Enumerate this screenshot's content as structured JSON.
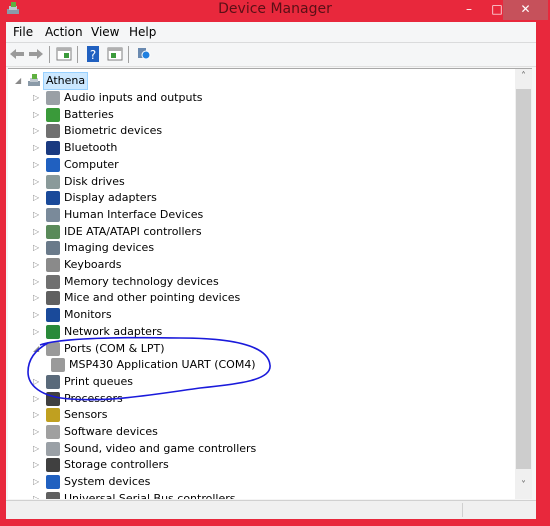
{
  "window": {
    "title": "Device Manager",
    "minimize_glyph": "–",
    "maximize_glyph": "□",
    "close_glyph": "✕"
  },
  "menu": [
    "File",
    "Action",
    "View",
    "Help"
  ],
  "toolbar": {
    "buttons": [
      "back-icon",
      "forward-icon",
      "show-hide-console-tree-icon",
      "help-icon",
      "show-hide-action-pane-icon",
      "scan-hardware-changes-icon"
    ]
  },
  "tree": {
    "root": {
      "label": "Athena",
      "expanded": true,
      "selected": true
    },
    "categories": [
      {
        "label": "Audio inputs and outputs",
        "icon": "speaker-icon",
        "expanded": false
      },
      {
        "label": "Batteries",
        "icon": "battery-icon",
        "expanded": false
      },
      {
        "label": "Biometric devices",
        "icon": "fingerprint-icon",
        "expanded": false
      },
      {
        "label": "Bluetooth",
        "icon": "bluetooth-icon",
        "expanded": false
      },
      {
        "label": "Computer",
        "icon": "computer-icon",
        "expanded": false
      },
      {
        "label": "Disk drives",
        "icon": "disk-drive-icon",
        "expanded": false
      },
      {
        "label": "Display adapters",
        "icon": "display-adapter-icon",
        "expanded": false
      },
      {
        "label": "Human Interface Devices",
        "icon": "hid-icon",
        "expanded": false
      },
      {
        "label": "IDE ATA/ATAPI controllers",
        "icon": "ide-controller-icon",
        "expanded": false
      },
      {
        "label": "Imaging devices",
        "icon": "imaging-device-icon",
        "expanded": false
      },
      {
        "label": "Keyboards",
        "icon": "keyboard-icon",
        "expanded": false
      },
      {
        "label": "Memory technology devices",
        "icon": "memory-device-icon",
        "expanded": false
      },
      {
        "label": "Mice and other pointing devices",
        "icon": "mouse-icon",
        "expanded": false
      },
      {
        "label": "Monitors",
        "icon": "monitor-icon",
        "expanded": false
      },
      {
        "label": "Network adapters",
        "icon": "network-adapter-icon",
        "expanded": false
      },
      {
        "label": "Ports (COM & LPT)",
        "icon": "port-icon",
        "expanded": true,
        "children": [
          {
            "label": "MSP430 Application UART (COM4)",
            "icon": "port-icon"
          }
        ]
      },
      {
        "label": "Print queues",
        "icon": "printer-icon",
        "expanded": false
      },
      {
        "label": "Processors",
        "icon": "processor-icon",
        "expanded": false
      },
      {
        "label": "Sensors",
        "icon": "sensor-icon",
        "expanded": false
      },
      {
        "label": "Software devices",
        "icon": "software-device-icon",
        "expanded": false
      },
      {
        "label": "Sound, video and game controllers",
        "icon": "speaker-icon",
        "expanded": false
      },
      {
        "label": "Storage controllers",
        "icon": "storage-controller-icon",
        "expanded": false
      },
      {
        "label": "System devices",
        "icon": "system-device-icon",
        "expanded": false
      },
      {
        "label": "Universal Serial Bus controllers",
        "icon": "usb-icon",
        "expanded": false
      }
    ]
  },
  "scrollbar": {
    "up_glyph": "˄",
    "down_glyph": "˅",
    "position_fraction": 0.0,
    "visible_fraction": 0.93
  },
  "annotation": {
    "color": "#1a1adb",
    "encircles": "Ports (COM & LPT) / MSP430 Application UART (COM4)"
  },
  "colors": {
    "title_bar": "#e8283c",
    "selection": "#cce8ff"
  }
}
